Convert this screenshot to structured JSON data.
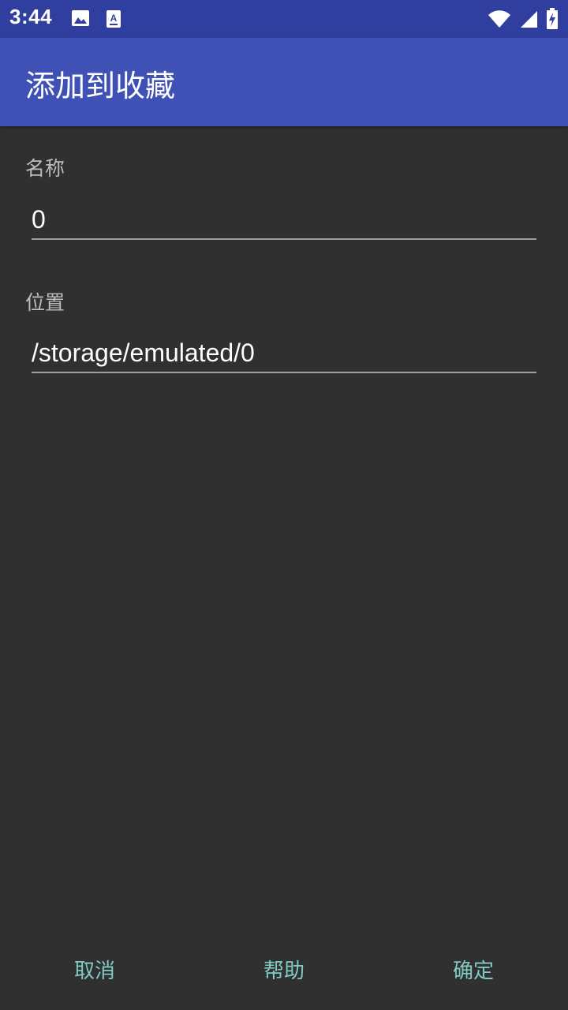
{
  "status_bar": {
    "time": "3:44",
    "left_icons": [
      "image-icon",
      "text-a-icon"
    ],
    "right_icons": [
      "wifi-icon",
      "signal-icon",
      "battery-charging-icon"
    ]
  },
  "app_bar": {
    "title": "添加到收藏"
  },
  "form": {
    "name_label": "名称",
    "name_value": "0",
    "location_label": "位置",
    "location_value": "/storage/emulated/0"
  },
  "footer": {
    "cancel_label": "取消",
    "help_label": "帮助",
    "ok_label": "确定"
  },
  "colors": {
    "status_bar": "#303f9f",
    "app_bar": "#3f51b5",
    "background": "#303030",
    "accent": "#80cbc4"
  }
}
